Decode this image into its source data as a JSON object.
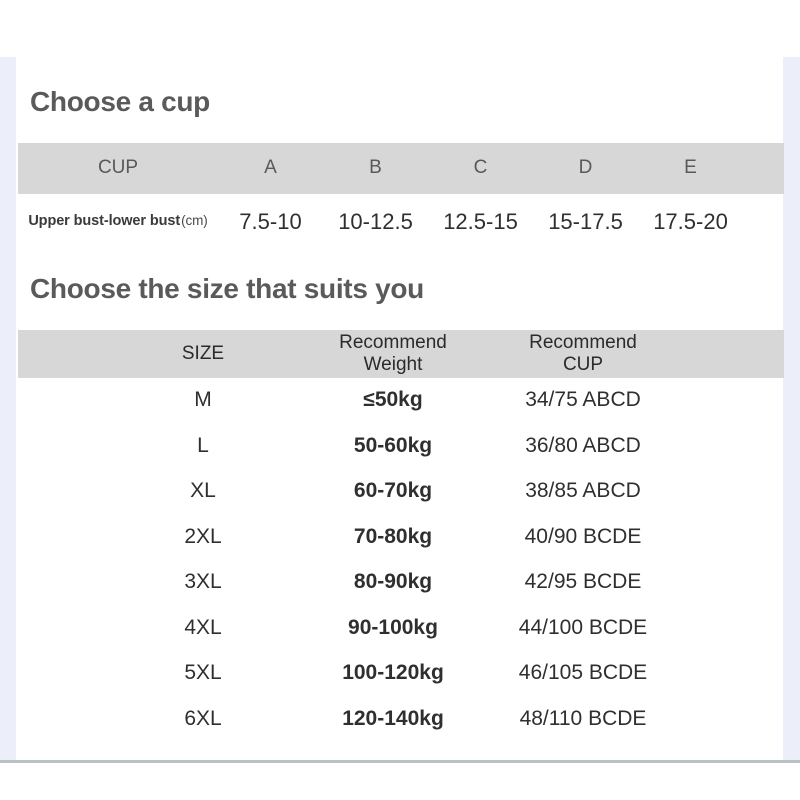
{
  "page": {
    "background_color": "#ffffff",
    "band_color": "#eceefa",
    "sheet_color": "#ffffff",
    "header_row_color": "#d7d7d7",
    "text_color": "#2f2f2f",
    "title_color": "#5a5a5a",
    "bottom_rule_color": "#b9c1c4"
  },
  "cup_section": {
    "title": "Choose a cup",
    "table": {
      "header": [
        "CUP",
        "A",
        "B",
        "C",
        "D",
        "E"
      ],
      "rows": [
        {
          "label": "Upper bust-lower bust",
          "label_unit": "(cm)",
          "values": [
            "7.5-10",
            "10-12.5",
            "12.5-15",
            "15-17.5",
            "17.5-20"
          ]
        }
      ]
    }
  },
  "size_section": {
    "title": "Choose the size that suits you",
    "table": {
      "header": [
        {
          "line1": "SIZE",
          "line2": ""
        },
        {
          "line1": "Recommend",
          "line2": "Weight"
        },
        {
          "line1": "Recommend",
          "line2": "CUP"
        }
      ],
      "rows": [
        {
          "size": "M",
          "weight": "≤50kg",
          "cup": "34/75 ABCD"
        },
        {
          "size": "L",
          "weight": "50-60kg",
          "cup": "36/80 ABCD"
        },
        {
          "size": "XL",
          "weight": "60-70kg",
          "cup": "38/85 ABCD"
        },
        {
          "size": "2XL",
          "weight": "70-80kg",
          "cup": "40/90 BCDE"
        },
        {
          "size": "3XL",
          "weight": "80-90kg",
          "cup": "42/95 BCDE"
        },
        {
          "size": "4XL",
          "weight": "90-100kg",
          "cup": "44/100 BCDE"
        },
        {
          "size": "5XL",
          "weight": "100-120kg",
          "cup": "46/105 BCDE"
        },
        {
          "size": "6XL",
          "weight": "120-140kg",
          "cup": "48/110 BCDE"
        }
      ]
    }
  }
}
